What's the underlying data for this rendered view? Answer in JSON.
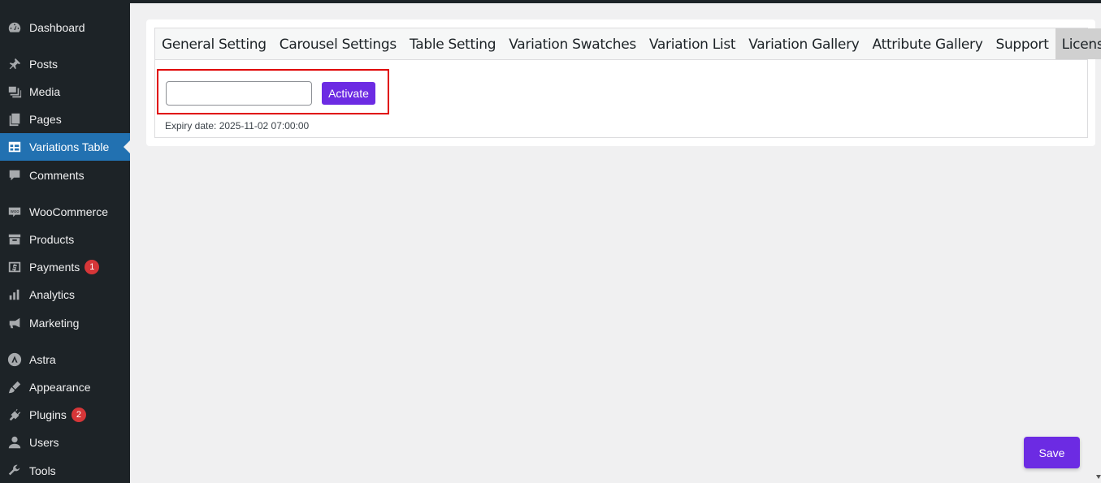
{
  "sidebar": {
    "items": [
      {
        "label": "Dashboard",
        "icon": "dashboard-icon"
      },
      {
        "label": "Posts",
        "icon": "pin-icon"
      },
      {
        "label": "Media",
        "icon": "media-icon"
      },
      {
        "label": "Pages",
        "icon": "pages-icon"
      },
      {
        "label": "Variations Table",
        "icon": "table-icon",
        "active": true
      },
      {
        "label": "Comments",
        "icon": "comment-icon"
      },
      {
        "label": "WooCommerce",
        "icon": "woo-icon"
      },
      {
        "label": "Products",
        "icon": "archive-icon"
      },
      {
        "label": "Payments",
        "icon": "dollar-icon",
        "badge": "1"
      },
      {
        "label": "Analytics",
        "icon": "bar-chart-icon"
      },
      {
        "label": "Marketing",
        "icon": "megaphone-icon"
      },
      {
        "label": "Astra",
        "icon": "astra-icon"
      },
      {
        "label": "Appearance",
        "icon": "brush-icon"
      },
      {
        "label": "Plugins",
        "icon": "plugin-icon",
        "badge": "2"
      },
      {
        "label": "Users",
        "icon": "user-icon"
      },
      {
        "label": "Tools",
        "icon": "wrench-icon"
      }
    ]
  },
  "tabs": [
    {
      "label": "General Setting"
    },
    {
      "label": "Carousel Settings"
    },
    {
      "label": "Table Setting"
    },
    {
      "label": "Variation Swatches"
    },
    {
      "label": "Variation List"
    },
    {
      "label": "Variation Gallery"
    },
    {
      "label": "Attribute Gallery"
    },
    {
      "label": "Support"
    },
    {
      "label": "License",
      "active": true
    }
  ],
  "license": {
    "input_value": "",
    "activate_label": "Activate",
    "expiry_text": "Expiry date: 2025-11-02 07:00:00"
  },
  "save_label": "Save",
  "colors": {
    "sidebar_bg": "#1d2327",
    "active_menu": "#2271b1",
    "button_purple": "#6c2be3",
    "highlight_red": "#e00000",
    "badge_red": "#d63638"
  }
}
